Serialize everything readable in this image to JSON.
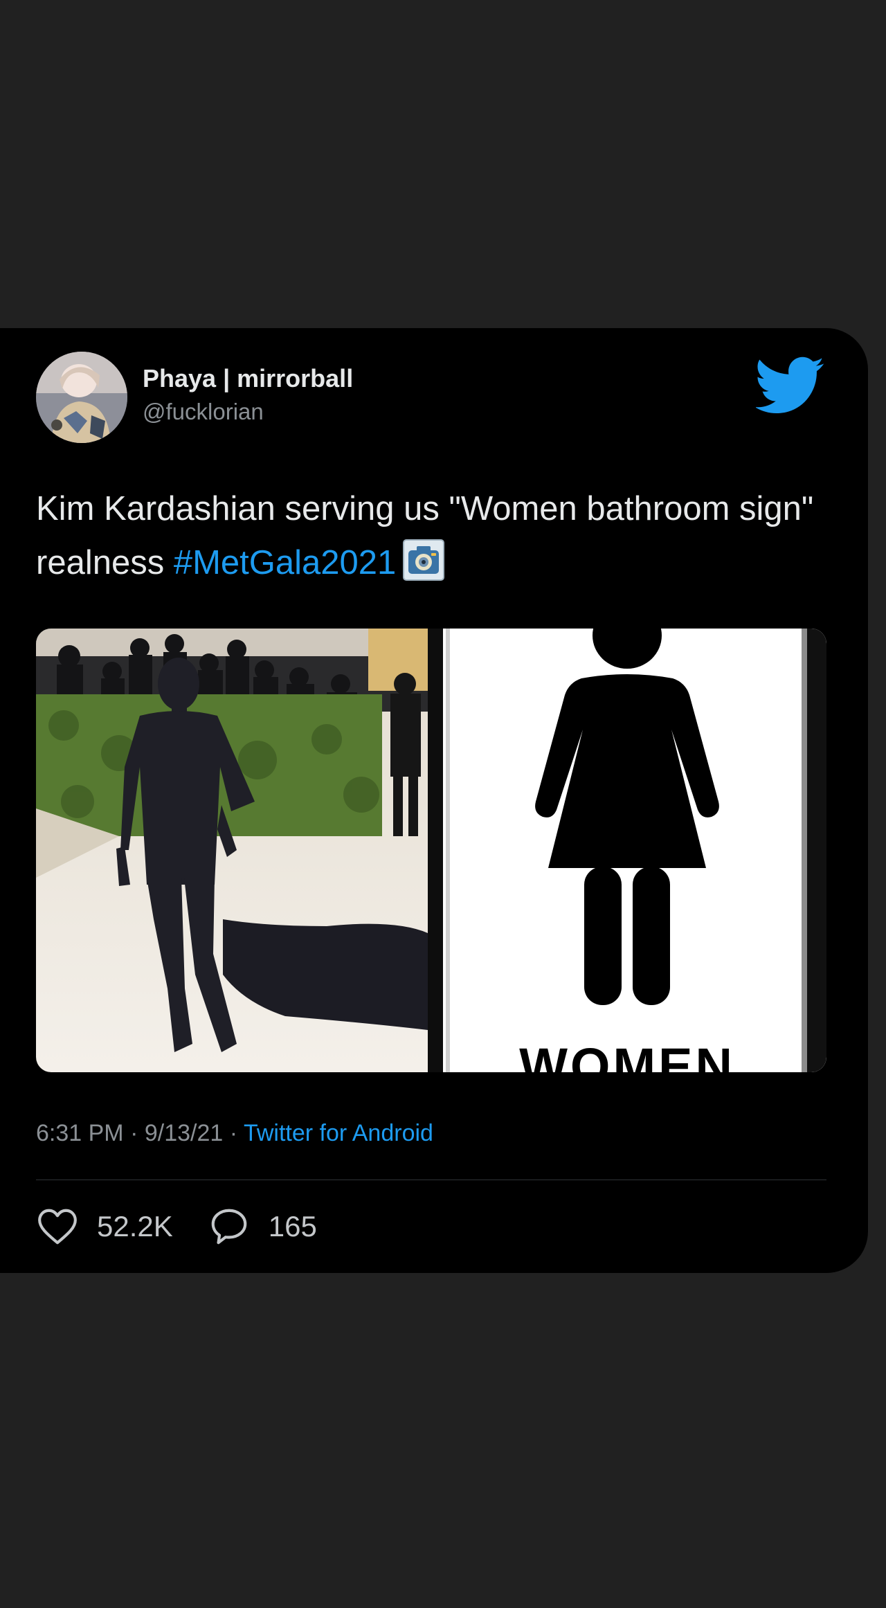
{
  "tweet": {
    "author": {
      "display_name": "Phaya | mirrorball",
      "handle": "@fucklorian"
    },
    "text_main": "Kim Kardashian serving us \"Women bathroom sign\" realness ",
    "hashtag": "#MetGala2021",
    "emoji_icon": "camera-emoji-icon",
    "media": {
      "left_image": "met-gala-photo",
      "right_image": "women-restroom-sign",
      "sign_text": "WOMEN"
    },
    "meta": {
      "time": "6:31 PM",
      "separator": "·",
      "date": "9/13/21",
      "source": "Twitter for Android"
    },
    "stats": {
      "likes": "52.2K",
      "replies": "165"
    }
  },
  "colors": {
    "page_background": "#212121",
    "card_background": "#000000",
    "accent": "#1d9bf0",
    "secondary_text": "#8b9095"
  },
  "icons": [
    "twitter-bird-icon",
    "heart-icon",
    "reply-bubble-icon",
    "camera-emoji-icon"
  ]
}
